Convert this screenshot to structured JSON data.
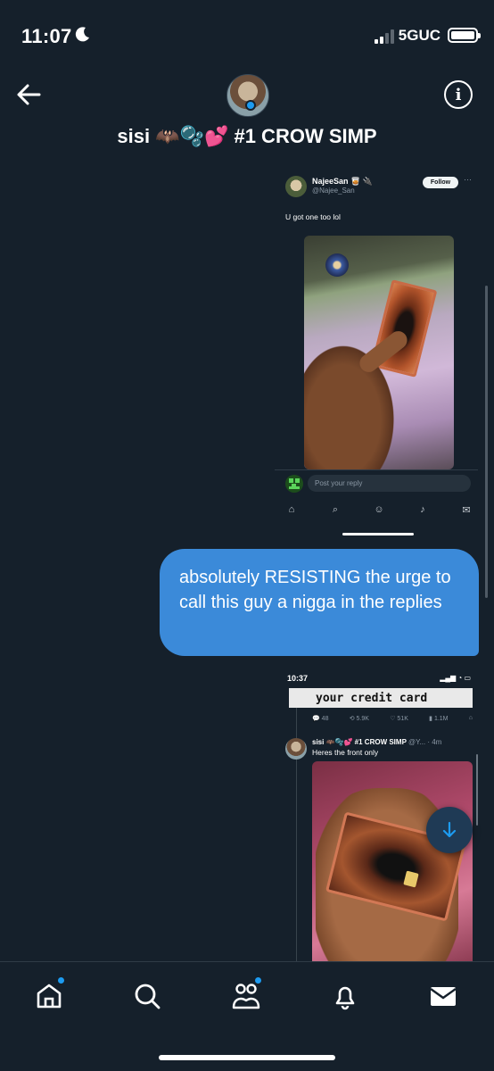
{
  "status_bar": {
    "time": "11:07",
    "network": "5GUC"
  },
  "header": {
    "title": "sisi 🦇🫧💕 #1 CROW SIMP"
  },
  "shared_post": {
    "display_name": "NajeeSan 🥃 🔌",
    "handle": "@Najee_San",
    "follow_label": "Follow",
    "more_label": "···",
    "text": "U got one too lol",
    "reply_placeholder": "Post your reply"
  },
  "message": {
    "text": "absolutely RESISTING the urge to call this guy a nigga in the replies"
  },
  "shared_screenshot": {
    "time": "10:37",
    "status_icons": "▂▄▆ ◔ ▭",
    "banner_text": "your credit card",
    "metrics": {
      "replies": "48",
      "reposts": "5.9K",
      "likes": "51K",
      "views": "1.1M"
    },
    "reply_name": "sisi 🦇🫧💕 #1 CROW SIMP",
    "reply_meta": "@Y... · 4m",
    "reply_text": "Heres the front only"
  },
  "bottom_nav": {
    "items": [
      {
        "name": "home",
        "notification": true
      },
      {
        "name": "search",
        "notification": false
      },
      {
        "name": "communities",
        "notification": true
      },
      {
        "name": "notifications",
        "notification": false
      },
      {
        "name": "messages",
        "notification": false
      }
    ]
  },
  "colors": {
    "background": "#15202b",
    "bubble": "#3b8ad9",
    "accent": "#1d9bf0"
  }
}
